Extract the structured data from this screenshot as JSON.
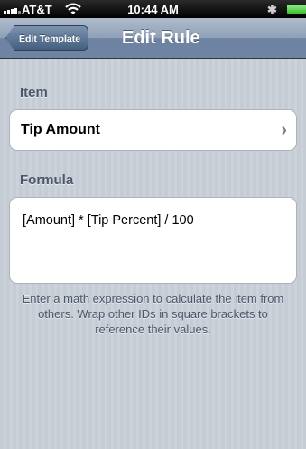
{
  "status_bar": {
    "carrier": "AT&T",
    "time": "10:44 AM",
    "bluetooth_icon": "bluetooth-icon",
    "wifi_icon": "wifi-icon",
    "battery_level": 1.0,
    "battery_color": "#3dbf33"
  },
  "nav": {
    "back_label": "Edit Template",
    "title": "Edit Rule"
  },
  "item_section": {
    "header": "Item",
    "value": "Tip Amount",
    "disclosure_icon": "chevron-right-icon"
  },
  "formula_section": {
    "header": "Formula",
    "value": "[Amount] * [Tip Percent] / 100"
  },
  "help_text": "Enter a math expression to calculate the item from others. Wrap other IDs in square brackets to reference their values."
}
